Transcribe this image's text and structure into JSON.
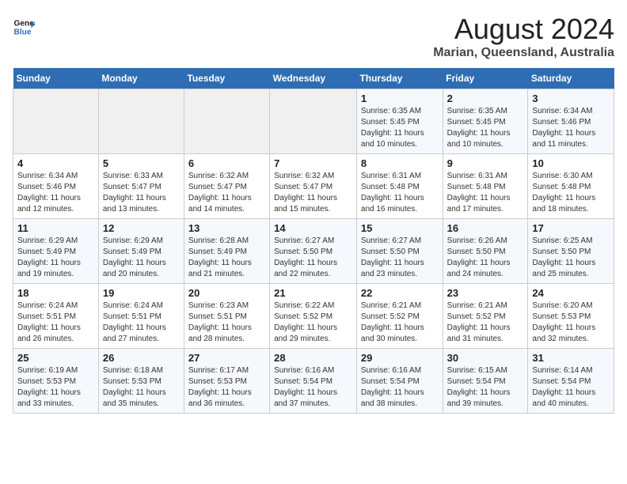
{
  "header": {
    "logo_line1": "General",
    "logo_line2": "Blue",
    "main_title": "August 2024",
    "subtitle": "Marian, Queensland, Australia"
  },
  "days_of_week": [
    "Sunday",
    "Monday",
    "Tuesday",
    "Wednesday",
    "Thursday",
    "Friday",
    "Saturday"
  ],
  "weeks": [
    [
      {
        "day": "",
        "info": ""
      },
      {
        "day": "",
        "info": ""
      },
      {
        "day": "",
        "info": ""
      },
      {
        "day": "",
        "info": ""
      },
      {
        "day": "1",
        "info": "Sunrise: 6:35 AM\nSunset: 5:45 PM\nDaylight: 11 hours\nand 10 minutes."
      },
      {
        "day": "2",
        "info": "Sunrise: 6:35 AM\nSunset: 5:45 PM\nDaylight: 11 hours\nand 10 minutes."
      },
      {
        "day": "3",
        "info": "Sunrise: 6:34 AM\nSunset: 5:46 PM\nDaylight: 11 hours\nand 11 minutes."
      }
    ],
    [
      {
        "day": "4",
        "info": "Sunrise: 6:34 AM\nSunset: 5:46 PM\nDaylight: 11 hours\nand 12 minutes."
      },
      {
        "day": "5",
        "info": "Sunrise: 6:33 AM\nSunset: 5:47 PM\nDaylight: 11 hours\nand 13 minutes."
      },
      {
        "day": "6",
        "info": "Sunrise: 6:32 AM\nSunset: 5:47 PM\nDaylight: 11 hours\nand 14 minutes."
      },
      {
        "day": "7",
        "info": "Sunrise: 6:32 AM\nSunset: 5:47 PM\nDaylight: 11 hours\nand 15 minutes."
      },
      {
        "day": "8",
        "info": "Sunrise: 6:31 AM\nSunset: 5:48 PM\nDaylight: 11 hours\nand 16 minutes."
      },
      {
        "day": "9",
        "info": "Sunrise: 6:31 AM\nSunset: 5:48 PM\nDaylight: 11 hours\nand 17 minutes."
      },
      {
        "day": "10",
        "info": "Sunrise: 6:30 AM\nSunset: 5:48 PM\nDaylight: 11 hours\nand 18 minutes."
      }
    ],
    [
      {
        "day": "11",
        "info": "Sunrise: 6:29 AM\nSunset: 5:49 PM\nDaylight: 11 hours\nand 19 minutes."
      },
      {
        "day": "12",
        "info": "Sunrise: 6:29 AM\nSunset: 5:49 PM\nDaylight: 11 hours\nand 20 minutes."
      },
      {
        "day": "13",
        "info": "Sunrise: 6:28 AM\nSunset: 5:49 PM\nDaylight: 11 hours\nand 21 minutes."
      },
      {
        "day": "14",
        "info": "Sunrise: 6:27 AM\nSunset: 5:50 PM\nDaylight: 11 hours\nand 22 minutes."
      },
      {
        "day": "15",
        "info": "Sunrise: 6:27 AM\nSunset: 5:50 PM\nDaylight: 11 hours\nand 23 minutes."
      },
      {
        "day": "16",
        "info": "Sunrise: 6:26 AM\nSunset: 5:50 PM\nDaylight: 11 hours\nand 24 minutes."
      },
      {
        "day": "17",
        "info": "Sunrise: 6:25 AM\nSunset: 5:50 PM\nDaylight: 11 hours\nand 25 minutes."
      }
    ],
    [
      {
        "day": "18",
        "info": "Sunrise: 6:24 AM\nSunset: 5:51 PM\nDaylight: 11 hours\nand 26 minutes."
      },
      {
        "day": "19",
        "info": "Sunrise: 6:24 AM\nSunset: 5:51 PM\nDaylight: 11 hours\nand 27 minutes."
      },
      {
        "day": "20",
        "info": "Sunrise: 6:23 AM\nSunset: 5:51 PM\nDaylight: 11 hours\nand 28 minutes."
      },
      {
        "day": "21",
        "info": "Sunrise: 6:22 AM\nSunset: 5:52 PM\nDaylight: 11 hours\nand 29 minutes."
      },
      {
        "day": "22",
        "info": "Sunrise: 6:21 AM\nSunset: 5:52 PM\nDaylight: 11 hours\nand 30 minutes."
      },
      {
        "day": "23",
        "info": "Sunrise: 6:21 AM\nSunset: 5:52 PM\nDaylight: 11 hours\nand 31 minutes."
      },
      {
        "day": "24",
        "info": "Sunrise: 6:20 AM\nSunset: 5:53 PM\nDaylight: 11 hours\nand 32 minutes."
      }
    ],
    [
      {
        "day": "25",
        "info": "Sunrise: 6:19 AM\nSunset: 5:53 PM\nDaylight: 11 hours\nand 33 minutes."
      },
      {
        "day": "26",
        "info": "Sunrise: 6:18 AM\nSunset: 5:53 PM\nDaylight: 11 hours\nand 35 minutes."
      },
      {
        "day": "27",
        "info": "Sunrise: 6:17 AM\nSunset: 5:53 PM\nDaylight: 11 hours\nand 36 minutes."
      },
      {
        "day": "28",
        "info": "Sunrise: 6:16 AM\nSunset: 5:54 PM\nDaylight: 11 hours\nand 37 minutes."
      },
      {
        "day": "29",
        "info": "Sunrise: 6:16 AM\nSunset: 5:54 PM\nDaylight: 11 hours\nand 38 minutes."
      },
      {
        "day": "30",
        "info": "Sunrise: 6:15 AM\nSunset: 5:54 PM\nDaylight: 11 hours\nand 39 minutes."
      },
      {
        "day": "31",
        "info": "Sunrise: 6:14 AM\nSunset: 5:54 PM\nDaylight: 11 hours\nand 40 minutes."
      }
    ]
  ]
}
